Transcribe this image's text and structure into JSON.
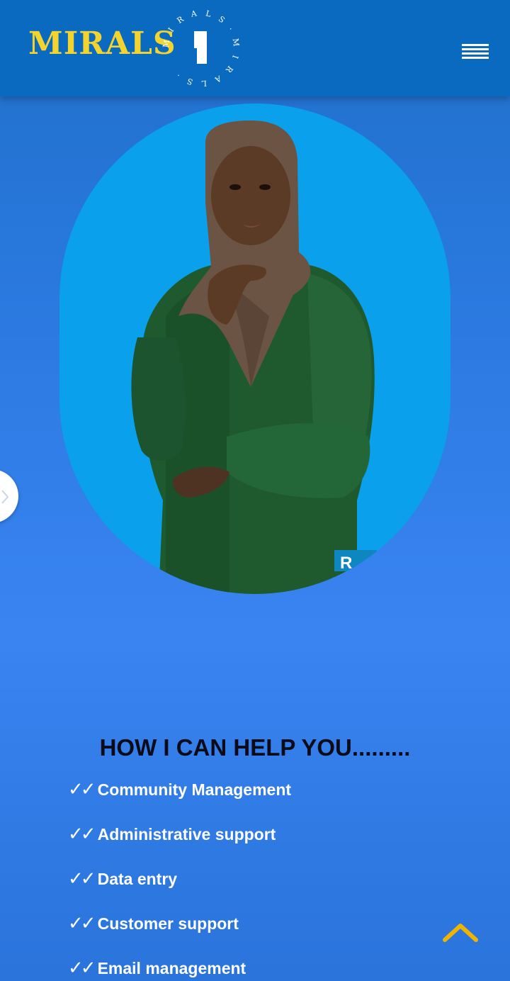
{
  "header": {
    "brand_name": "MIRALS",
    "seal_text": "M I R A L S · M I R A L S ·",
    "brand_color": "#f3d42e",
    "menu_icon": "hamburger-icon"
  },
  "hero": {
    "watermark": "R",
    "background_color": "#0aa0ec"
  },
  "side_tab": {
    "icon": "chevron-right-icon"
  },
  "services": {
    "title": "HOW I CAN HELP YOU.........",
    "check_mark": "✓✓",
    "items": [
      "Community Management",
      "Administrative support",
      "Data entry",
      "Customer support",
      "Email management"
    ]
  },
  "scroll_top": {
    "icon": "chevron-up-icon",
    "color": "#f0b400"
  }
}
